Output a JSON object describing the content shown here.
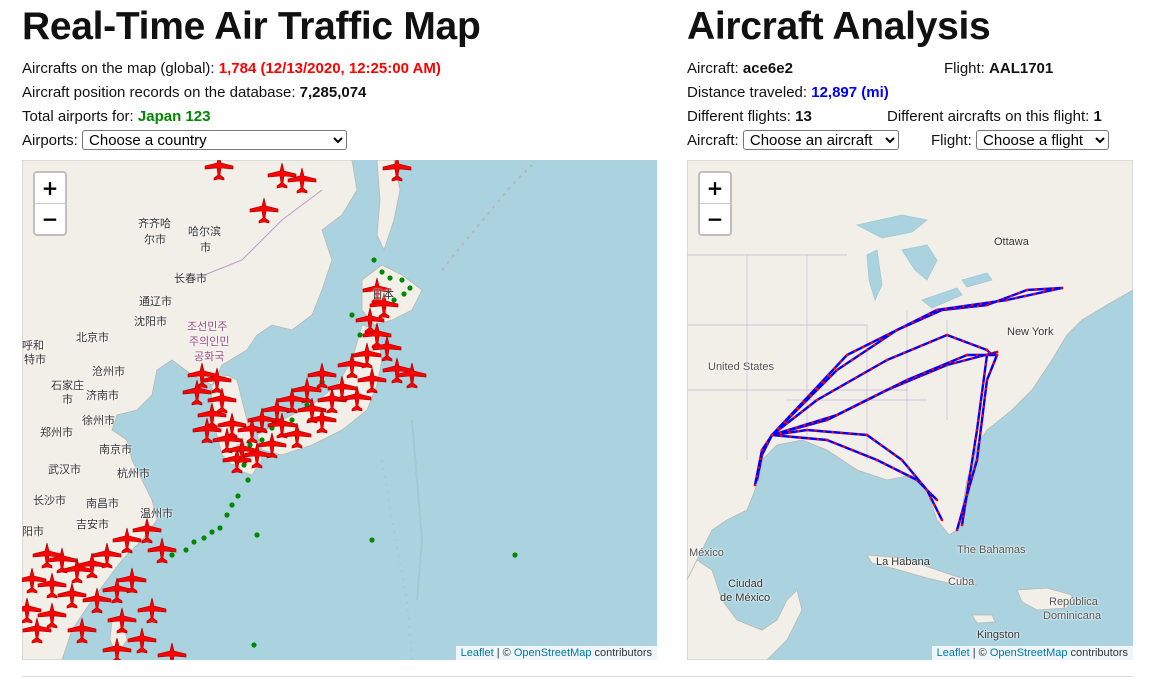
{
  "left": {
    "title": "Real-Time Air Traffic Map",
    "aircrafts_label": "Aircrafts on the map (global):",
    "aircrafts_value": "1,784 (12/13/2020, 12:25:00 AM)",
    "records_label": "Aircraft position records on the database:",
    "records_value": "7,285,074",
    "airports_total_label": "Total airports for:",
    "airports_total_value": "Japan 123",
    "airports_select_label": "Airports:",
    "airports_select_value": "Choose a country",
    "map_labels": {
      "qiqihar": "齐齐哈",
      "qiqihar2": "尔市",
      "harbin": "哈尔滨",
      "harbin2": "市",
      "changchun": "长春市",
      "tonghua": "通辽市",
      "shenyang": "沈阳市",
      "dprk1": "조선민주",
      "dprk2": "주의인민",
      "dprk3": "공화국",
      "beijing": "北京市",
      "hohhot1": "呼和",
      "hohhot2": "特市",
      "cangzhou": "沧州市",
      "shijiazhuang1": "石家庄",
      "shijiazhuang2": "市",
      "jinan": "济南市",
      "xuzhou": "徐州市",
      "zhengzhou": "郑州市",
      "nanjing": "南京市",
      "hangzhou": "杭州市",
      "wuhan": "武汉市",
      "changsha": "长沙市",
      "nanchang": "南昌市",
      "wenzhou": "温州市",
      "jian": "吉安市",
      "yang": "阳市",
      "japan": "日本"
    },
    "attribution": {
      "leaflet": "Leaflet",
      "sep": " | © ",
      "osm": "OpenStreetMap",
      "contrib": " contributors"
    }
  },
  "right": {
    "title": "Aircraft Analysis",
    "aircraft_label": "Aircraft:",
    "aircraft_value": "ace6e2",
    "flight_label": "Flight:",
    "flight_value": "AAL1701",
    "distance_label": "Distance traveled:",
    "distance_value": "12,897 (mi)",
    "diff_flights_label": "Different flights:",
    "diff_flights_value": "13",
    "diff_aircrafts_label": "Different aircrafts on this flight:",
    "diff_aircrafts_value": "1",
    "aircraft_select_label": "Aircraft:",
    "aircraft_select_value": "Choose an aircraft",
    "flight_select_label": "Flight:",
    "flight_select_value": "Choose a flight",
    "map_labels": {
      "ottawa": "Ottawa",
      "newyork": "New York",
      "us": "United States",
      "mexico": "México",
      "cdmx1": "Ciudad",
      "cdmx2": "de México",
      "habana": "La Habana",
      "cuba": "Cuba",
      "bahamas": "The Bahamas",
      "rd1": "República",
      "rd2": "Dominicana",
      "kingston": "Kingston"
    },
    "attribution": {
      "leaflet": "Leaflet",
      "sep": " | © ",
      "osm": "OpenStreetMap",
      "contrib": " contributors"
    }
  },
  "zoom": {
    "in": "+",
    "out": "−"
  },
  "colors": {
    "aircraft_marker": "#ff0000",
    "airport_marker": "#008800",
    "route": "#0000ff",
    "route_points": "#ff0000",
    "water": "#aad3df",
    "land": "#f2efe9"
  }
}
